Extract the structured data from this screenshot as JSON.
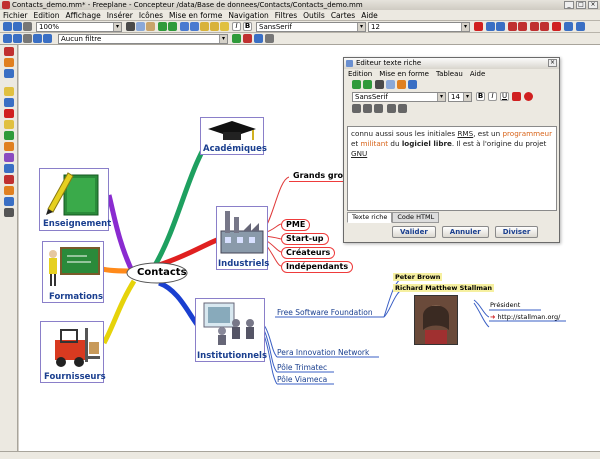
{
  "window": {
    "title": "Contacts_demo.mm* - Freeplane - Concepteur /data/Base de donnees/Contacts/Contacts_demo.mm"
  },
  "menu": [
    "Fichier",
    "Edition",
    "Affichage",
    "Insérer",
    "Icônes",
    "Mise en forme",
    "Navigation",
    "Filtres",
    "Outils",
    "Cartes",
    "Aide"
  ],
  "toolbar": {
    "zoom": "100%",
    "font": "SansSerif",
    "size": "12",
    "filter": "Aucun filtre"
  },
  "mindmap": {
    "root": "Contacts",
    "branches": {
      "academiques": "Académiques",
      "enseignement": "Enseignement",
      "formations": "Formations",
      "fournisseurs": "Fournisseurs",
      "industriels": "Industriels",
      "institutionnels": "Institutionnels"
    },
    "industriels_children": [
      "Grands groupes",
      "PME",
      "Start-up",
      "Créateurs",
      "Indépendants"
    ],
    "institutionnels_children": [
      "Free Software Foundation",
      "Pera Innovation Network",
      "Pôle Trimatec",
      "Pôle Viameca"
    ],
    "people": {
      "peter": "Peter Brown",
      "richard": "Richard Matthew Stallman",
      "role": "Président",
      "url": "http://stallman.org/"
    }
  },
  "dialog": {
    "title": "Editeur texte riche",
    "menu": [
      "Edition",
      "Mise en forme",
      "Tableau",
      "Aide"
    ],
    "font": "SansSerif",
    "size": "14",
    "text": {
      "p1": "connu aussi sous les initiales ",
      "rms": "RMS",
      "p2": ", est un ",
      "programmeur": "programmeur",
      "p3": "et ",
      "militant": "militant",
      "p4": " du ",
      "logiciel": "logiciel libre",
      "p5": ". Il est à l'origine du projet ",
      "gnu": "GNU"
    },
    "tabs": [
      "Texte riche",
      "Code HTML"
    ],
    "buttons": [
      "Valider",
      "Annuler",
      "Diviser"
    ]
  }
}
